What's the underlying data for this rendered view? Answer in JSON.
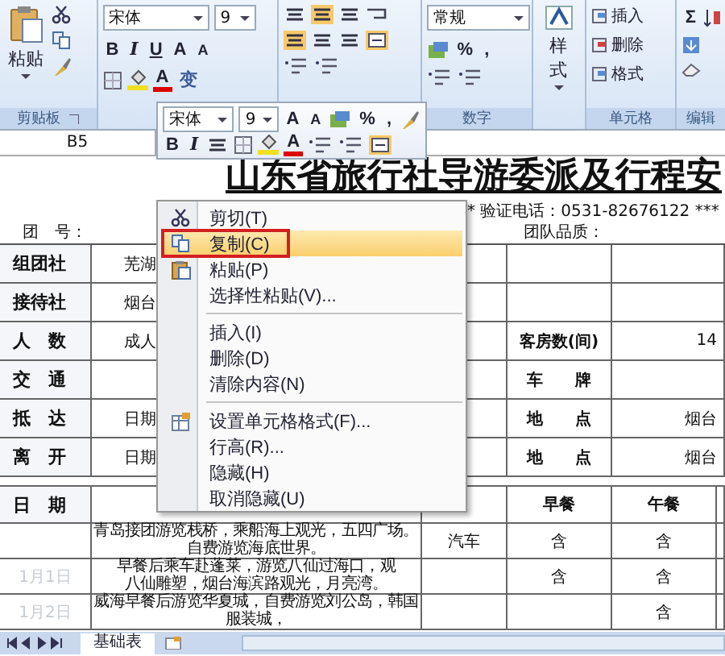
{
  "ribbon": {
    "clipboard": {
      "paste": "粘贴",
      "group_label": "剪贴板"
    },
    "font": {
      "font_name": "宋体",
      "font_size": "9",
      "bold": "B",
      "italic": "I",
      "underline": "U",
      "grow": "A",
      "shrink": "A",
      "font_color": "A",
      "phonetic": "变"
    },
    "number": {
      "format": "常规",
      "percent": "%",
      "comma": ",",
      "group_label": "数字"
    },
    "styles": {
      "label": "样式"
    },
    "cells": {
      "buttons": [
        "插入",
        "删除",
        "格式"
      ],
      "group_label": "单元格"
    },
    "editing": {
      "sum": "Σ",
      "group_label": "编辑"
    }
  },
  "name_box": "B5",
  "mini_toolbar": {
    "font_name": "宋体",
    "font_size": "9",
    "grow": "A",
    "shrink": "A",
    "percent": "%",
    "comma": ",",
    "bold": "B",
    "italic": "I",
    "font_color": "A"
  },
  "sheet": {
    "title": "山东省旅行社导游委派及行程安",
    "verify": "* 验证电话：0531-82676122 ***",
    "team_no": "团　号：",
    "quality": "团队品质：",
    "info_rows": [
      {
        "label": "组团社",
        "value": "芜湖"
      },
      {
        "label": "接待社",
        "value": "烟台"
      },
      {
        "label": "人　数",
        "value": "成人",
        "label_2": "客房数(间)",
        "value_2": "14"
      },
      {
        "label": "交　通",
        "label_2": "车　　牌"
      },
      {
        "label": "抵　达",
        "value": "日期",
        "label_2": "地　　点",
        "value_2": "烟台"
      },
      {
        "label": "离　开",
        "value": "日期",
        "label_2": "地　　点",
        "value_2": "烟台"
      }
    ],
    "schedule_header": {
      "label": "日　期",
      "columns": [
        "早餐",
        "午餐"
      ]
    },
    "schedule_rows": [
      {
        "date": "",
        "itinerary": [
          "青岛接团游览栈桥，乘船海上观光，五四广场。",
          "自费游览海底世界。"
        ],
        "transport": "汽车",
        "breakfast": "含",
        "lunch": "含"
      },
      {
        "date": "1月1日",
        "itinerary": [
          "早餐后乘车赴蓬莱，游览八仙过海口，观",
          "八仙雕塑，烟台海滨路观光，月亮湾。"
        ],
        "transport": "",
        "breakfast": "含",
        "lunch": "含"
      },
      {
        "date": "1月2日",
        "itinerary": [
          "威海早餐后游览华夏城，自费游览刘公岛，韩国",
          "服装城，"
        ],
        "transport": "",
        "breakfast": "",
        "lunch": "含"
      }
    ]
  },
  "context_menu": [
    {
      "kind": "item",
      "label": "剪切(T)",
      "selected": false
    },
    {
      "kind": "item",
      "label": "复制(C)",
      "selected": true
    },
    {
      "kind": "item",
      "label": "粘贴(P)",
      "selected": false
    },
    {
      "kind": "item",
      "label": "选择性粘贴(V)...",
      "selected": false
    },
    {
      "kind": "separator"
    },
    {
      "kind": "item",
      "label": "插入(I)",
      "selected": false
    },
    {
      "kind": "item",
      "label": "删除(D)",
      "selected": false
    },
    {
      "kind": "item",
      "label": "清除内容(N)",
      "selected": false
    },
    {
      "kind": "separator"
    },
    {
      "kind": "item",
      "label": "设置单元格格式(F)...",
      "selected": false
    },
    {
      "kind": "item",
      "label": "行高(R)...",
      "selected": false
    },
    {
      "kind": "item",
      "label": "隐藏(H)",
      "selected": false
    },
    {
      "kind": "item",
      "label": "取消隐藏(U)",
      "selected": false
    }
  ],
  "sheet_tabs": [
    {
      "label": "基础表",
      "selected": true
    }
  ]
}
